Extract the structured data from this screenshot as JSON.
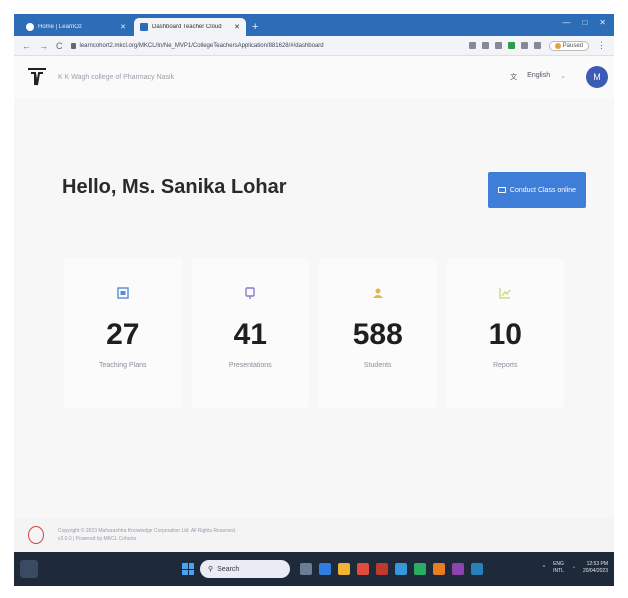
{
  "browser": {
    "tabs": [
      {
        "label": "Home | LearnOz",
        "active": false
      },
      {
        "label": "Dashboard Teacher Cloud",
        "active": true
      }
    ],
    "new_tab_label": "+",
    "url": "learncohort2.mkcl.org/MKCL/In/Ne_MVP1/CollegeTeachersApplication/881628/#/dashboard",
    "profile_label": "Paused"
  },
  "header": {
    "college_name": "K K Wagh college of Pharmacy Nasik",
    "language": "English",
    "avatar_initial": "M"
  },
  "main": {
    "greeting": "Hello, Ms. Sanika Lohar",
    "conduct_button": "Conduct Class online",
    "stats": [
      {
        "value": "27",
        "label": "Teaching Plans",
        "icon": "plan-icon",
        "color": "#5b8bd6"
      },
      {
        "value": "41",
        "label": "Presentations",
        "icon": "presentation-icon",
        "color": "#8a7bd6"
      },
      {
        "value": "588",
        "label": "Students",
        "icon": "students-icon",
        "color": "#e0b84a"
      },
      {
        "value": "10",
        "label": "Reports",
        "icon": "reports-icon",
        "color": "#c9d98a"
      }
    ]
  },
  "footer": {
    "copyright": "Copyright © 2023 Maharashtra Knowledge Corporation Ltd. All Rights Reserved.",
    "powered": "v2.0.0 | Powered by MKCL Cohorts"
  },
  "taskbar": {
    "search_label": "Search",
    "lang_code": "ENG",
    "region": "INTL",
    "time": "12:53 PM",
    "date": "20/04/2023"
  },
  "colors": {
    "accent": "#3f7ed8",
    "tabbar": "#2d6db8",
    "avatar": "#3b5bb5"
  }
}
